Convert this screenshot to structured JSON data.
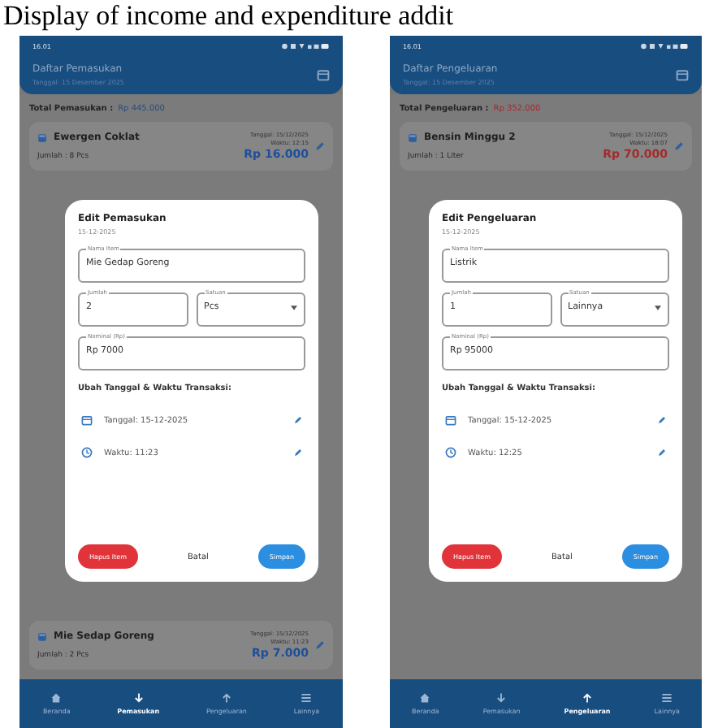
{
  "caption": "Display of income and expenditure addit",
  "phones": [
    {
      "kind": "income",
      "time": "16.01",
      "title": "Daftar Pemasukan",
      "subtitle": "Tanggal: 15 Desember 2025",
      "total_label": "Total Pemasukan :",
      "total_value": "Rp 445.000",
      "items_top": [
        {
          "name": "Ewergen Coklat",
          "qty": "Jumlah : 8 Pcs",
          "date": "Tanggal: 15/12/2025",
          "time": "Waktu: 12:15",
          "amount": "Rp 16.000"
        }
      ],
      "items_bottom": [
        {
          "name": "Mie Sedap Goreng",
          "qty": "Jumlah : 2 Pcs",
          "date": "Tanggal: 15/12/2025",
          "time": "Waktu: 11:23",
          "amount": "Rp 7.000"
        }
      ],
      "dialog": {
        "title": "Edit Pemasukan",
        "date": "15-12-2025",
        "fields": [
          {
            "label": "Nama Item",
            "value": "Mie Gedap Goreng"
          },
          {
            "label": "Jumlah",
            "value": "2"
          },
          {
            "label": "Satuan",
            "value": "Pcs",
            "kind": "dropdown"
          },
          {
            "label": "Nominal (Rp)",
            "value": "Rp 7000"
          }
        ],
        "section": "Ubah Tanggal & Waktu Transaksi:",
        "date_row": "Tanggal: 15-12-2025",
        "time_row": "Waktu: 11:23",
        "buttons": [
          "Hapus Item",
          "Batal",
          "Simpan"
        ]
      },
      "nav": [
        {
          "label": "Beranda",
          "selected": false
        },
        {
          "label": "Pemasukan",
          "selected": true
        },
        {
          "label": "Pengeluaran",
          "selected": false
        },
        {
          "label": "Lainnya",
          "selected": false
        }
      ]
    },
    {
      "kind": "expense",
      "time": "16.01",
      "title": "Daftar Pengeluaran",
      "subtitle": "Tanggal: 15 Desember 2025",
      "total_label": "Total Pengeluaran :",
      "total_value": "Rp 352.000",
      "items_top": [
        {
          "name": "Bensin Minggu 2",
          "qty": "Jumlah : 1 Liter",
          "date": "Tanggal: 15/12/2025",
          "time": "Waktu: 18:07",
          "amount": "Rp 70.000"
        }
      ],
      "dialog": {
        "title": "Edit Pengeluaran",
        "date": "15-12-2025",
        "fields": [
          {
            "label": "Nama Item",
            "value": "Listrik"
          },
          {
            "label": "Jumlah",
            "value": "1"
          },
          {
            "label": "Satuan",
            "value": "Lainnya",
            "kind": "dropdown"
          },
          {
            "label": "Nominal (Rp)",
            "value": "Rp 95000"
          }
        ],
        "section": "Ubah Tanggal & Waktu Transaksi:",
        "date_row": "Tanggal: 15-12-2025",
        "time_row": "Waktu: 12:25",
        "buttons": [
          "Hapus Item",
          "Batal",
          "Simpan"
        ]
      },
      "nav": [
        {
          "label": "Beranda",
          "selected": false
        },
        {
          "label": "Pemasukan",
          "selected": false
        },
        {
          "label": "Pengeluaran",
          "selected": true
        },
        {
          "label": "Lainnya",
          "selected": false
        }
      ]
    }
  ]
}
